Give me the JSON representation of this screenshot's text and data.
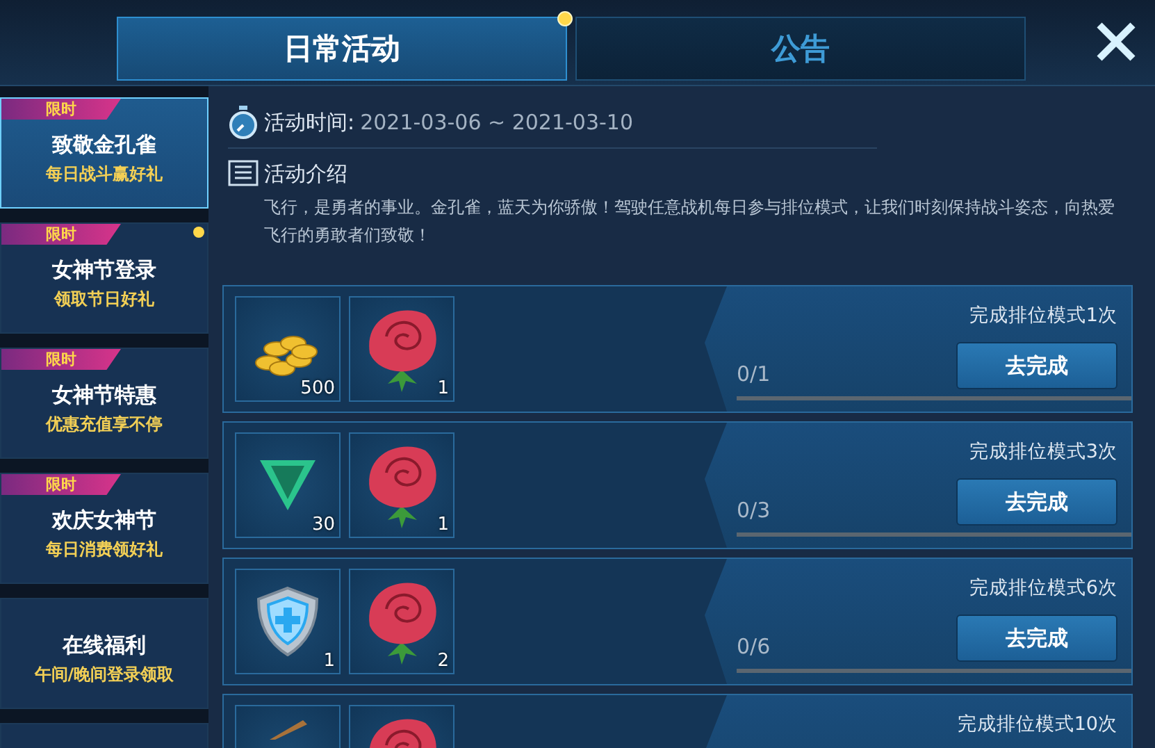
{
  "tabs": [
    {
      "label": "日常活动",
      "selected": true,
      "badge": true
    },
    {
      "label": "公告",
      "selected": false,
      "badge": false
    }
  ],
  "sidebar": {
    "items": [
      {
        "tag": "限时",
        "title": "致敬金孔雀",
        "subtitle": "每日战斗赢好礼",
        "selected": true,
        "badge": false
      },
      {
        "tag": "限时",
        "title": "女神节登录",
        "subtitle": "领取节日好礼",
        "selected": false,
        "badge": true
      },
      {
        "tag": "限时",
        "title": "女神节特惠",
        "subtitle": "优惠充值享不停",
        "selected": false,
        "badge": false
      },
      {
        "tag": "限时",
        "title": "欢庆女神节",
        "subtitle": "每日消费领好礼",
        "selected": false,
        "badge": false
      },
      {
        "title": "在线福利",
        "subtitle": "午间/晚间登录领取",
        "selected": false,
        "badge": false
      },
      {
        "selected": false,
        "badge": false
      }
    ]
  },
  "activity": {
    "time_label": "活动时间:",
    "time_value": "2021-03-06 ~ 2021-03-10",
    "intro_label": "活动介绍",
    "intro_text": "飞行，是勇者的事业。金孔雀，蓝天为你骄傲！驾驶任意战机每日参与排位模式，让我们时刻保持战斗姿态，向热爱飞行的勇敢者们致敬！"
  },
  "tasks": [
    {
      "rewards": [
        {
          "kind": "coins",
          "count": "500"
        },
        {
          "kind": "rose",
          "count": "1"
        }
      ],
      "title": "完成排位模式1次",
      "progress": "0/1",
      "level": 0,
      "button": "去完成"
    },
    {
      "rewards": [
        {
          "kind": "gem",
          "count": "30"
        },
        {
          "kind": "rose",
          "count": "1"
        }
      ],
      "title": "完成排位模式3次",
      "progress": "0/3",
      "level": 0,
      "button": "去完成"
    },
    {
      "rewards": [
        {
          "kind": "shield",
          "count": "1"
        },
        {
          "kind": "rose",
          "count": "2"
        }
      ],
      "title": "完成排位模式6次",
      "progress": "0/6",
      "level": 0,
      "button": "去完成"
    },
    {
      "rewards": [
        {
          "kind": "stick"
        },
        {
          "kind": "rose"
        }
      ],
      "title": "完成排位模式10次"
    }
  ]
}
